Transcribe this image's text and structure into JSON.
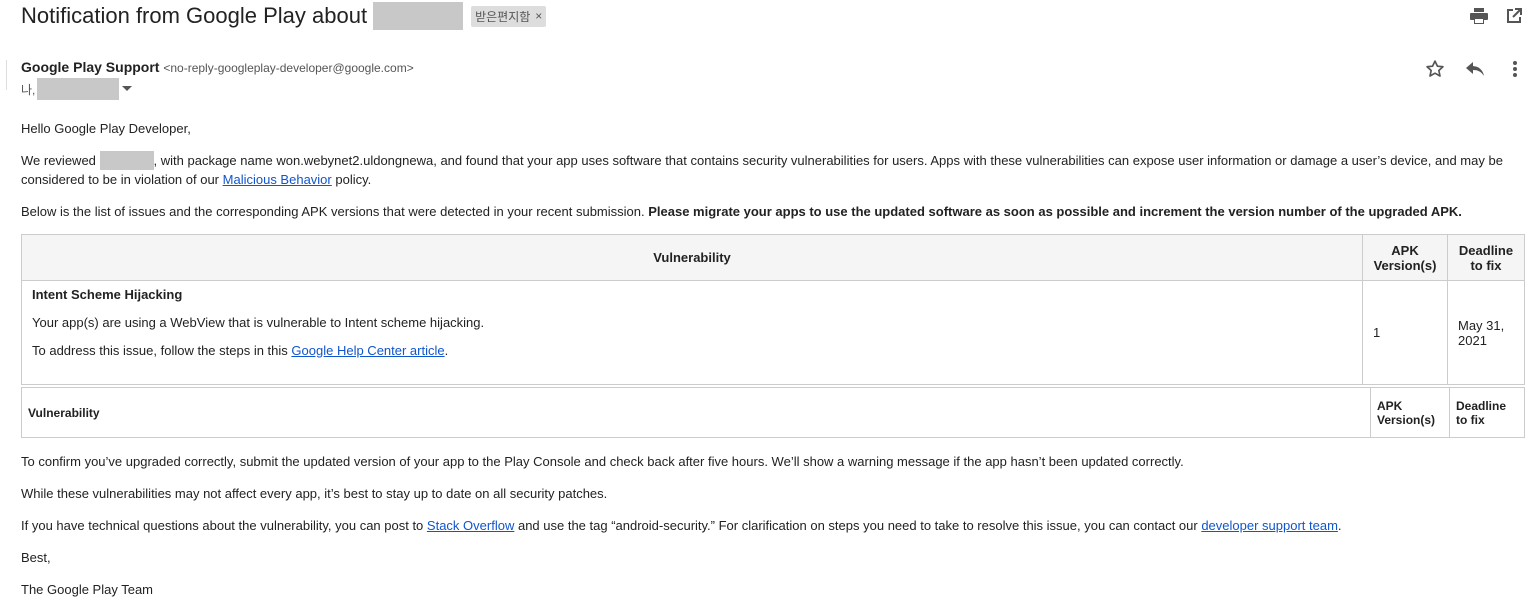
{
  "email": {
    "subject": "Notification from Google Play about",
    "label": "받은편지함",
    "label_remove": "×",
    "sender_name": "Google Play Support",
    "sender_email": "<no-reply-googleplay-developer@google.com>",
    "recipient_prefix": "나,",
    "greeting": "Hello Google Play Developer,",
    "p1_a": "We reviewed",
    "p1_b": ", with package name won.webynet2.uldongnewa, and found that your app uses software that contains security vulnerabilities for users. Apps with these vulnerabilities can expose user information or damage a user’s device, and may be considered to be in violation of our",
    "p1_link": "Malicious Behavior",
    "p1_c": "policy.",
    "p2_a": "Below is the list of issues and the corresponding APK versions that were detected in your recent submission.",
    "p2_bold": "Please migrate your apps to use the updated software as soon as possible and increment the version number of the upgraded APK.",
    "table1": {
      "headers": [
        "Vulnerability",
        "APK Version(s)",
        "Deadline to fix"
      ],
      "issue_title": "Intent Scheme Hijacking",
      "issue_desc": "Your app(s) are using a WebView that is vulnerable to Intent scheme hijacking.",
      "issue_fix_a": "To address this issue, follow the steps in this",
      "issue_fix_link": "Google Help Center article",
      "issue_fix_b": ".",
      "apk_version": "1",
      "deadline": "May 31, 2021"
    },
    "table2": {
      "headers": [
        "Vulnerability",
        "APK Version(s)",
        "Deadline to fix"
      ]
    },
    "p3": "To confirm you’ve upgraded correctly, submit the updated version of your app to the Play Console and check back after five hours. We’ll show a warning message if the app hasn’t been updated correctly.",
    "p4": "While these vulnerabilities may not affect every app, it’s best to stay up to date on all security patches.",
    "p5_a": "If you have technical questions about the vulnerability, you can post to",
    "p5_link1": "Stack Overflow",
    "p5_b": "and use the tag “android-security.” For clarification on steps you need to take to resolve this issue, you can contact our",
    "p5_link2": "developer support team",
    "p5_c": ".",
    "sign1": "Best,",
    "sign2": "The Google Play Team"
  },
  "icons": {
    "print": "print-icon",
    "open_new": "open-in-new-window-icon",
    "star": "star-icon",
    "reply": "reply-icon",
    "more": "more-vertical-icon",
    "dropdown": "chevron-down-icon"
  }
}
